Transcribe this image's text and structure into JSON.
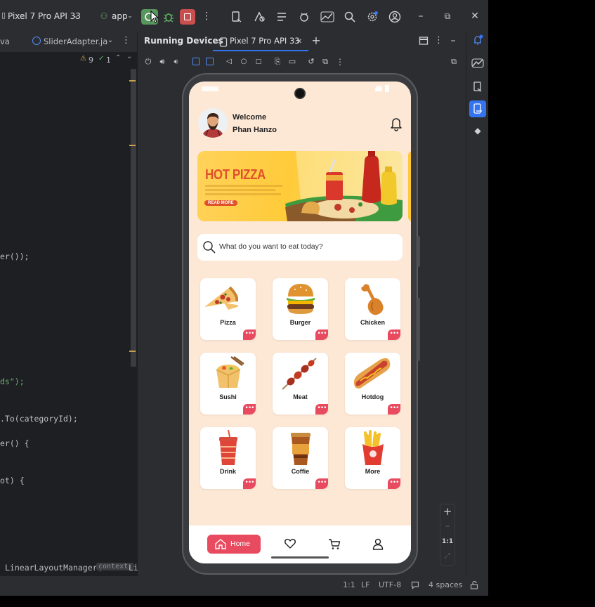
{
  "titlebar": {
    "device_label": "Pixel 7 Pro API 33",
    "app_label": "app"
  },
  "editor_tabs": {
    "partial_tab": "va",
    "active_file": "SliderAdapter.ja",
    "warnings": "9",
    "checks": "1"
  },
  "editor_lines": [
    "er());",
    "ds\");",
    ".To(categoryId);",
    "er() {",
    "ot) {",
    "LinearLayoutManager("
  ],
  "editor_hint": {
    "param": "context:",
    "after": "Li"
  },
  "devices_panel": {
    "title": "Running Devices",
    "device_tab": "Pixel 7 Pro API 33"
  },
  "app_screen": {
    "welcome": "Welcome",
    "user_name": "Phan Hanzo",
    "banner": {
      "headline": "HOT PIZZA",
      "button": "READ MORE"
    },
    "search_placeholder": "What do you want to eat today?",
    "categories": [
      {
        "label": "Pizza",
        "icon": "pizza-icon"
      },
      {
        "label": "Burger",
        "icon": "burger-icon"
      },
      {
        "label": "Chicken",
        "icon": "chicken-icon"
      },
      {
        "label": "Sushi",
        "icon": "sushi-icon"
      },
      {
        "label": "Meat",
        "icon": "meat-icon"
      },
      {
        "label": "Hotdog",
        "icon": "hotdog-icon"
      },
      {
        "label": "Drink",
        "icon": "drink-icon"
      },
      {
        "label": "Coffie",
        "icon": "coffee-icon"
      },
      {
        "label": "More",
        "icon": "fries-icon"
      }
    ],
    "nav": {
      "home_label": "Home"
    }
  },
  "zoom": {
    "ratio_label": "1:1"
  },
  "statusbar": {
    "position": "1:1",
    "line_ending": "LF",
    "encoding": "UTF-8",
    "indent": "4 spaces"
  },
  "colors": {
    "accent_red": "#e84a5f",
    "screen_bg": "#fde8d6",
    "ide_bg": "#1e1f22",
    "ide_panel": "#2b2d30",
    "active_blue": "#3574f0"
  }
}
